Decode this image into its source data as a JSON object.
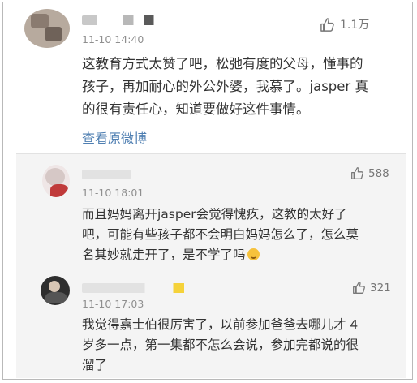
{
  "comment": {
    "time": "11-10 14:40",
    "likes": "1.1万",
    "text": [
      "这教育方式太赞了吧，松弛有度的父母，懂事的",
      "孩子，再加耐心的外公外婆，我慕了。jasper 真",
      "的很有责任心，知道要做好这件事情。"
    ],
    "link": "查看原微博"
  },
  "replies": [
    {
      "time": "11-10 18:01",
      "likes": "588",
      "text": [
        "而且妈妈离开jasper会觉得愧疚，这教的太好了",
        "吧，可能有些孩子都不会明白妈妈怎么了，怎么莫",
        "名其妙就走开了，是不学了吗"
      ],
      "emoji": "laughing-face-emoji"
    },
    {
      "time": "11-10 17:03",
      "likes": "321",
      "text": [
        "我觉得嘉士伯很厉害了，以前参加爸爸去哪儿才 4",
        "岁多一点，第一集都不怎么会说，参加完都说的很",
        "溜了"
      ]
    }
  ],
  "colors": {
    "text": "#333333",
    "meta": "#8f8f8f",
    "link": "#4f7fb2",
    "reply_bg": "#f4f4f4"
  },
  "icons": {
    "like": "thumbs-up-icon"
  }
}
